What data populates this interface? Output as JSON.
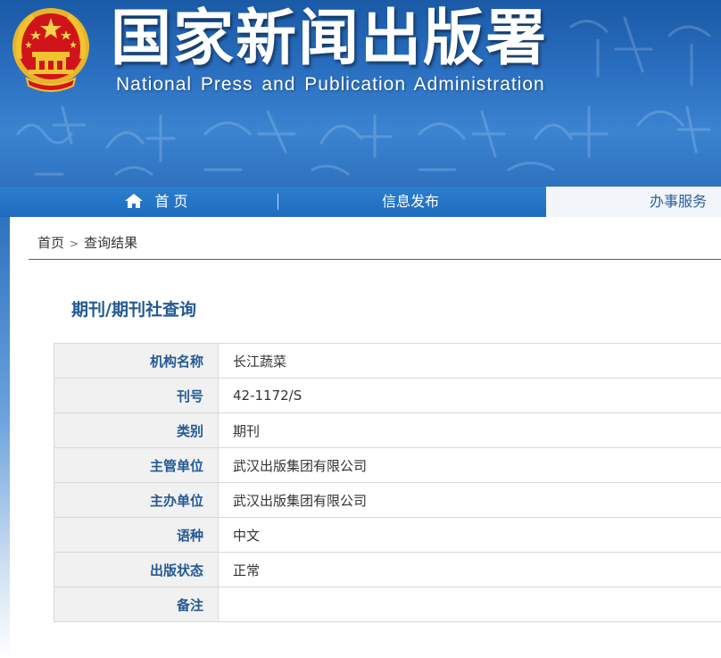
{
  "header": {
    "title": "国家新闻出版署",
    "subtitle": "National  Press and Publication Administration"
  },
  "nav": {
    "home": "首 页",
    "info": "信息发布",
    "service": "办事服务"
  },
  "breadcrumb": {
    "home": "首页",
    "separator": ">",
    "current": "查询结果"
  },
  "page": {
    "title": "期刊/期刊社查询"
  },
  "table": {
    "rows": [
      {
        "label": "机构名称",
        "value": "长江蔬菜"
      },
      {
        "label": "刊号",
        "value": "42-1172/S"
      },
      {
        "label": "类别",
        "value": "期刊"
      },
      {
        "label": "主管单位",
        "value": "武汉出版集团有限公司"
      },
      {
        "label": "主办单位",
        "value": "武汉出版集团有限公司"
      },
      {
        "label": "语种",
        "value": "中文"
      },
      {
        "label": "出版状态",
        "value": "正常"
      },
      {
        "label": "备注",
        "value": ""
      }
    ]
  },
  "icons": {
    "emblem": "national-emblem-icon",
    "home": "home-icon"
  },
  "colors": {
    "banner_blue": "#2a6fc0",
    "title_blue": "#235a93",
    "emblem_red": "#d1141b",
    "emblem_gold": "#f2c331"
  }
}
